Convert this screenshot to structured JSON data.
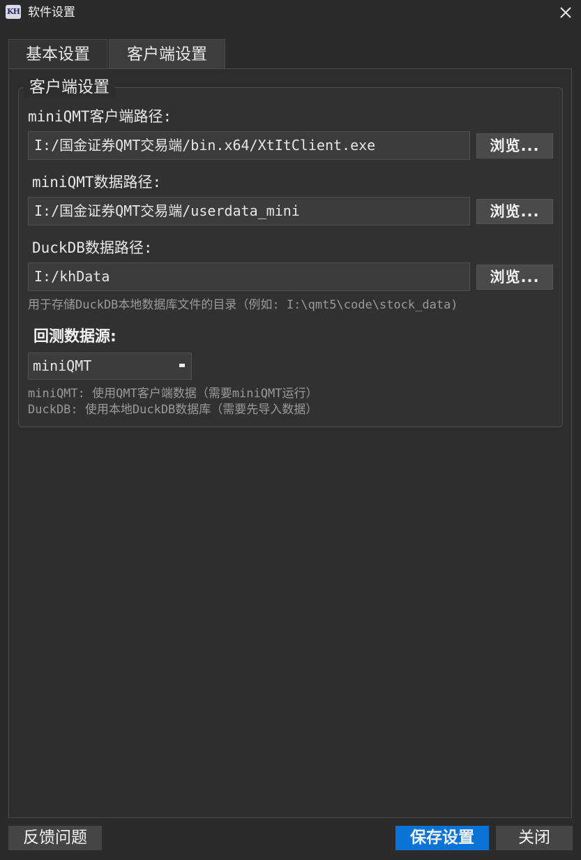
{
  "window": {
    "title": "软件设置",
    "logo_text": "KH"
  },
  "tabs": [
    {
      "label": "基本设置",
      "active": false
    },
    {
      "label": "客户端设置",
      "active": true
    }
  ],
  "group": {
    "title": "客户端设置",
    "fields": [
      {
        "label": "miniQMT客户端路径:",
        "value": "I:/国金证券QMT交易端/bin.x64/XtItClient.exe",
        "browse_label": "浏览..."
      },
      {
        "label": "miniQMT数据路径:",
        "value": "I:/国金证券QMT交易端/userdata_mini",
        "browse_label": "浏览..."
      },
      {
        "label": "DuckDB数据路径:",
        "value": "I:/khData",
        "browse_label": "浏览..."
      }
    ],
    "duckdb_hint": "用于存储DuckDB本地数据库文件的目录（例如: I:\\qmt5\\code\\stock_data)",
    "backtest_source": {
      "title": "回测数据源:",
      "selected": "miniQMT",
      "hints": [
        "miniQMT: 使用QMT客户端数据（需要miniQMT运行）",
        "DuckDB: 使用本地DuckDB数据库（需要先导入数据）"
      ]
    }
  },
  "footer": {
    "feedback_label": "反馈问题",
    "save_label": "保存设置",
    "close_label": "关闭"
  },
  "colors": {
    "background": "#2b2b2b",
    "accent": "#0a74d6",
    "button": "#454545",
    "hint_text": "#9a9a9a"
  }
}
